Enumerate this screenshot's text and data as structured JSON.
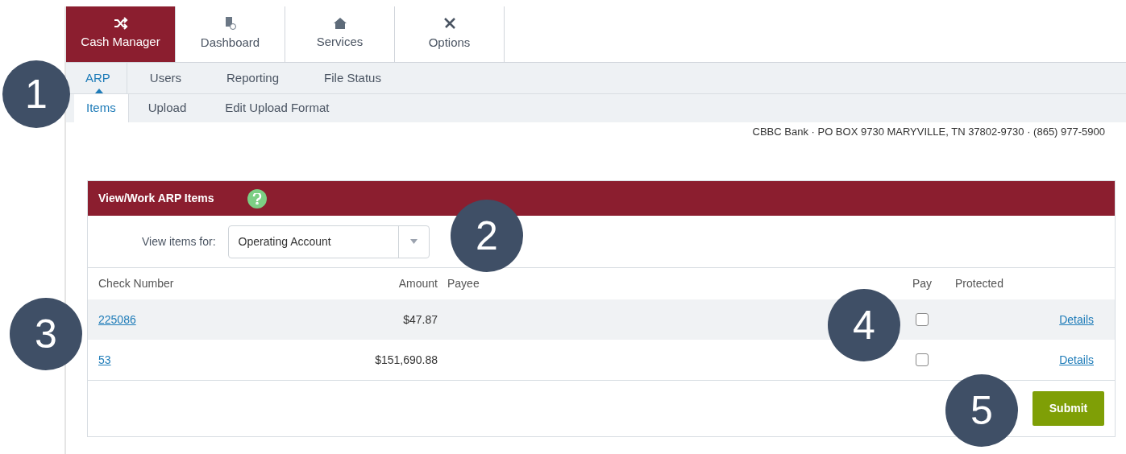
{
  "top_nav": [
    {
      "label": "Cash Manager",
      "selected": true
    },
    {
      "label": "Dashboard",
      "selected": false
    },
    {
      "label": "Services",
      "selected": false
    },
    {
      "label": "Options",
      "selected": false
    }
  ],
  "sub_nav": [
    {
      "label": "ARP",
      "selected": true
    },
    {
      "label": "Users",
      "selected": false
    },
    {
      "label": "Reporting",
      "selected": false
    },
    {
      "label": "File Status",
      "selected": false
    }
  ],
  "sub_sub_nav": [
    {
      "label": "Items",
      "selected": true
    },
    {
      "label": "Upload",
      "selected": false
    },
    {
      "label": "Edit Upload Format",
      "selected": false
    }
  ],
  "bank_info": "CBBC Bank · PO BOX 9730 MARYVILLE, TN 37802-9730 · (865) 977-5900",
  "panel": {
    "title": "View/Work ARP Items",
    "filter_label": "View items for:",
    "account": "Operating Account",
    "columns": [
      "Check Number",
      "Amount",
      "Payee",
      "Pay",
      "Protected"
    ],
    "rows": [
      {
        "check_number": "225086",
        "amount": "$47.87",
        "pay_checked": false,
        "link": "Details"
      },
      {
        "check_number": "53",
        "amount": "$151,690.88",
        "pay_checked": false,
        "link": "Details"
      }
    ],
    "submit": "Submit"
  },
  "callouts": [
    "1",
    "2",
    "3",
    "4",
    "5"
  ]
}
